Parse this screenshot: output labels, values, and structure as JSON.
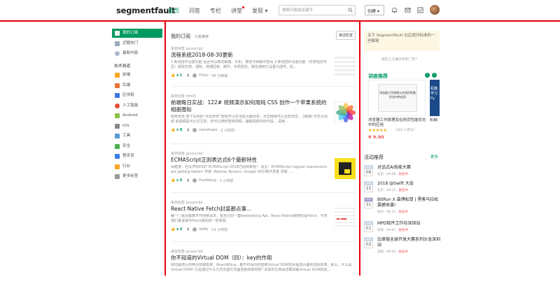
{
  "header": {
    "logo": "segmentfault",
    "nav": [
      "首页",
      "问答",
      "专栏",
      "讲堂",
      "发现 ▾"
    ],
    "search_placeholder": "搜索问题或关键字",
    "create_label": "创建 ▾"
  },
  "sidebar": {
    "top_items": [
      "我的订阅",
      "近期热门",
      "最新内容"
    ],
    "section_label": "技术频道",
    "channels": [
      "前端",
      "后端",
      "区块链",
      "人工智能",
      "Android",
      "iOS",
      "工具",
      "安全",
      "程序员",
      "行业",
      "更多标签"
    ]
  },
  "feed": {
    "title": "我的订阅",
    "subtitle": "只看推荐",
    "settings_label": "推送配置",
    "posts": [
      {
        "source": "来自标签 javascript",
        "title": "流程系统2018-08-30更新",
        "excerpt": "1.新增指号设置功能 后台可以绑定邮箱、手机、微信号和邮件密码 2.新增插件设置功能（仅管理员可见）获取文档、通知、快捷回复、邮件、手机短信、微信通知已设置为插件。后...",
        "votes": "x 1",
        "author": "Fntys",
        "time": "45 分钟前"
      },
      {
        "source": "来自标签 html5",
        "title": "前端每日实战：122# 视频演示如何用纯 CSS 创作一个苹果系统的相册图标",
        "excerpt": "效果预览 按下右侧的“点击预览”按钮可以在当前页面预览，点击链接可以全屏预览。 [链接] 可交互视频 此视频是可以交互的，你可以随时暂停视频，编辑视频中的代码。 请用...",
        "votes": "x 8",
        "author": "comehope",
        "time": "2 小时前"
      },
      {
        "source": "来自标签 javascript",
        "title": "ECMAScript正则表达式6个最新特性",
        "excerpt": "译者按：还没学好ES6? ECMAScript 2018已经到来啦！ 原文：ECMAScript regular expressions are getting better! 作者: Mathias Bynens: Google V8引擎开发者 译者: ...",
        "votes": "x 6",
        "author": "Fundebug",
        "time": "2 小时前"
      },
      {
        "source": "来自标签 javascript",
        "title": "React Native Fetch封装那点事...",
        "excerpt": "每一门语言都离不开网络请求，有自己的一套Networking Api。React Native使用的是Fetch。今天我们来谈谈与Fetch相关的一些事情。",
        "votes": "x 4",
        "author": "idsfkj",
        "time": "13 小时前"
      },
      {
        "source": "来自标签 javascript",
        "title": "你不知道的Virtual DOM（四）：key的作用",
        "excerpt": "目前最流行的两大前端框架，React和Vue，都不约而同的借助Virtual DOM技术提高页面的渲染效率。那么，什么是Virtual DOM? 它是通过什么方式去提升页面渲染效率的呢? 本系列文章会详细讲解Virtual DOM的创...",
        "votes": "",
        "author": "",
        "time": ""
      }
    ]
  },
  "right": {
    "notice": "关于 SegmentFault 社区提问标准的一些解释",
    "ad_question": "想在上方展示你的广告?",
    "recommend_title": "讲座推荐",
    "book_cover": "浏览器工作原理与在网页性能优化中的应用",
    "book_title": "浏览器工作原理及在网页性能优化中的应用",
    "book2_cover": "机器学习 Py",
    "book2_title": "机械",
    "stars": "★★★★★",
    "ratings": "(182 人参与)",
    "price": "¥ 9.90",
    "activity_title": "活动推荐",
    "more_label": "更多",
    "events": [
      {
        "mon": "SEP",
        "day": "08",
        "name": "对话式AI技能大赛",
        "city": "北京",
        "date": "09-08",
        "status": "报名中"
      },
      {
        "mon": "SEP",
        "day": "15",
        "name": "2018 @Swift 大会",
        "city": "北京",
        "date": "09-15",
        "status": "报名中"
      },
      {
        "mon": "AUG",
        "day": "31",
        "name": "BitRun X 森博松鼠 | 黑客马拉松震撼来袭!",
        "city": "杭州",
        "date": "08-31",
        "status": "报名中"
      },
      {
        "mon": "SEP",
        "day": "01",
        "name": "MPD软件工作坊深圳站",
        "city": "深圳",
        "date": "09-01",
        "status": "报名中"
      },
      {
        "mon": "SEP",
        "day": "02",
        "name": "比原链全球开发大赛系列沙龙深圳站",
        "city": "深圳",
        "date": "09-02",
        "status": "报名中"
      }
    ]
  },
  "colors": {
    "brand": "#009a61",
    "accent_line": "#e8000b"
  }
}
